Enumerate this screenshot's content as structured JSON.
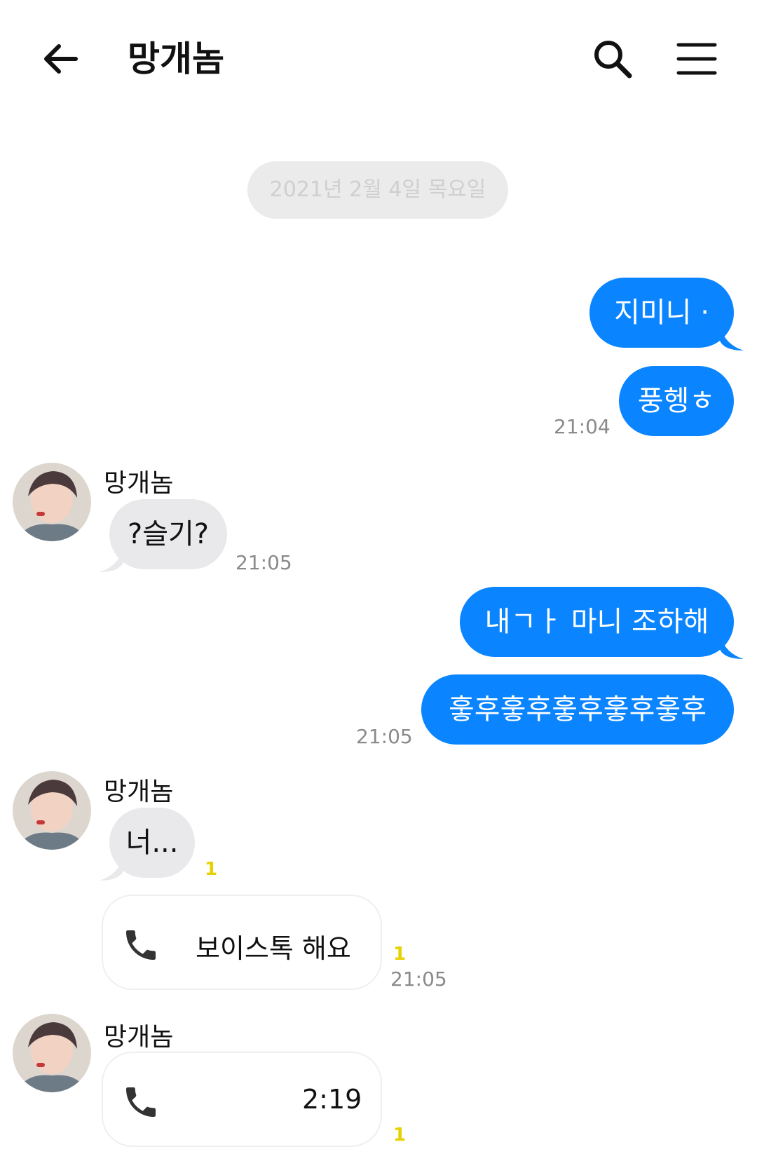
{
  "header": {
    "title": "망개놈",
    "back_icon": "arrow-left-icon",
    "search_icon": "search-icon",
    "menu_icon": "hamburger-menu-icon"
  },
  "date_divider": "2021년 2월 4일 목요일",
  "messages": {
    "sent_1a": "지미니 ·",
    "sent_1b": "풍헹ㅎ",
    "sent_1_time": "21:04",
    "recv_1_name": "망개놈",
    "recv_1_text": "?슬기?",
    "recv_1_time": "21:05",
    "sent_2a": "내ㄱㅏ 마니 조하해",
    "sent_2b": "훟후훟후훟후훟후훟후",
    "sent_2_time": "21:05",
    "recv_2_name": "망개놈",
    "recv_2_text": "너...",
    "recv_2_unread": "1",
    "voice_1_label": "보이스톡 해요",
    "voice_1_unread": "1",
    "voice_1_time": "21:05",
    "recv_3_name": "망개놈",
    "voice_2_label": "2:19",
    "voice_2_unread": "1"
  },
  "colors": {
    "sent_bubble": "#0a84ff",
    "received_bubble": "#e9e9eb",
    "unread": "#e6d200"
  }
}
